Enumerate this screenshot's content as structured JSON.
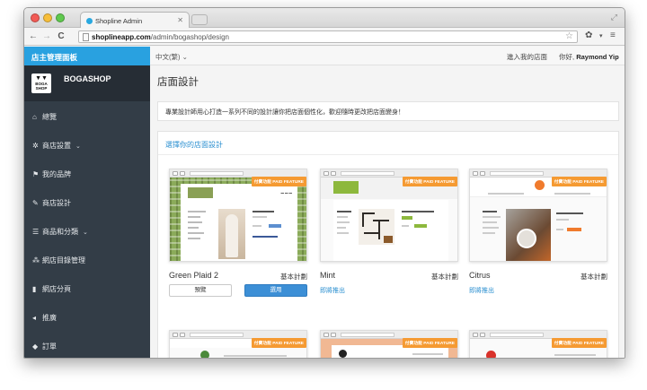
{
  "browser": {
    "tab_title": "Shopline Admin",
    "url_domain": "shoplineapp.com",
    "url_path": "/admin/bogashop/design"
  },
  "sidebar": {
    "header": "店主管理面板",
    "brand_name": "BOGASHOP",
    "logo_text": "BOGA SHOP",
    "items": [
      {
        "label": "總覽",
        "icon": "home-icon",
        "has_caret": false
      },
      {
        "label": "商店設置",
        "icon": "gear-icon",
        "has_caret": true
      },
      {
        "label": "我的品牌",
        "icon": "flag-icon",
        "has_caret": false
      },
      {
        "label": "商店設計",
        "icon": "pencil-icon",
        "has_caret": false
      },
      {
        "label": "商品和分類",
        "icon": "list-icon",
        "has_caret": true
      },
      {
        "label": "網店目錄管理",
        "icon": "sitemap-icon",
        "has_caret": false
      },
      {
        "label": "網店分頁",
        "icon": "file-icon",
        "has_caret": false
      },
      {
        "label": "推廣",
        "icon": "megaphone-icon",
        "has_caret": false
      },
      {
        "label": "訂單",
        "icon": "tag-icon",
        "has_caret": false
      }
    ]
  },
  "topbar": {
    "language": "中文(繁)",
    "visit_store": "進入我的店面",
    "greeting_prefix": "你好,",
    "user_name": "Raymond Yip"
  },
  "main": {
    "title": "店面設計",
    "intro": "專業設計師用心打造一系列不同的設計讓你把店面個性化，歡迎隨時更改把店面變身！",
    "choose_title": "選擇你的店面設計",
    "paid_badge": "付費功能 PAID FEATURE",
    "themes": [
      {
        "name": "Green Plaid 2",
        "plan": "基本計劃",
        "preview_label": "預覽",
        "apply_label": "選用",
        "status": ""
      },
      {
        "name": "Mint",
        "plan": "基本計劃",
        "preview_label": "",
        "apply_label": "",
        "status": "即將推出"
      },
      {
        "name": "Citrus",
        "plan": "基本計劃",
        "preview_label": "",
        "apply_label": "",
        "status": "即將推出"
      }
    ]
  },
  "colors": {
    "sidebar_bg": "#333d47",
    "sidebar_header": "#29a1e0",
    "accent_link": "#2a8fd0",
    "apply_button": "#3c8fd6",
    "paid_badge": "#f59a32"
  }
}
